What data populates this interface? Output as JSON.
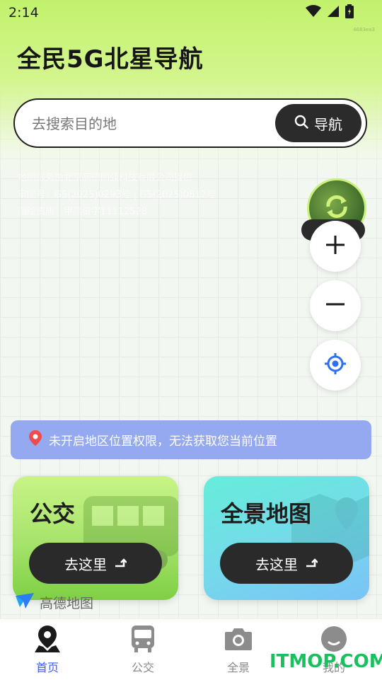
{
  "status_bar": {
    "time": "2:14"
  },
  "app": {
    "title": "全民5G北星导航",
    "tiny_code": "4683ea3"
  },
  "search": {
    "placeholder": "去搜索目的地",
    "button_label": "导航"
  },
  "map_notice": {
    "line1": "地图服务由北京高德图强科技有限公司提供",
    "line2": "审图号：GS(2025)0293号 | GS(2025)0817号",
    "line3": "测绘资质：甲测资字11112528"
  },
  "refresh": {
    "label": "刷新"
  },
  "location_banner": {
    "text": "未开启地区位置权限，无法获取您当前位置"
  },
  "cards": [
    {
      "title": "公交",
      "button": "去这里"
    },
    {
      "title": "全景地图",
      "button": "去这里"
    }
  ],
  "map_logo": {
    "text": "高德地图"
  },
  "bottom_nav": {
    "items": [
      {
        "label": "首页",
        "active": true
      },
      {
        "label": "公交",
        "active": false
      },
      {
        "label": "全景",
        "active": false
      },
      {
        "label": "我的",
        "active": false
      }
    ]
  },
  "watermark": "ITMOP.COM",
  "colors": {
    "accent_green": "#c2f26c",
    "nav_active": "#3c5eea",
    "banner": "#94a9f0",
    "dark_button": "#2b2b2b"
  }
}
